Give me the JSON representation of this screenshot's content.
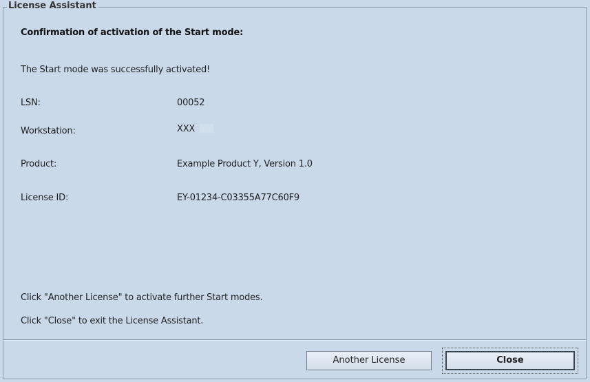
{
  "window": {
    "group_title": "License Assistant"
  },
  "content": {
    "heading": "Confirmation of activation of the Start mode:",
    "message": "The Start mode was successfully activated!",
    "fields": [
      {
        "label": "LSN:",
        "value": "00052"
      },
      {
        "label": "Workstation:",
        "value": "XXX"
      },
      {
        "label": "Product:",
        "value": "Example Product Y, Version  1.0"
      },
      {
        "label": "License ID:",
        "value": "EY-01234-C03355A77C60F9"
      }
    ],
    "hint_another": "Click \"Another License\" to activate further Start modes.",
    "hint_close": "Click \"Close\" to exit the License Assistant."
  },
  "buttons": {
    "another_license": "Another License",
    "close": "Close"
  }
}
